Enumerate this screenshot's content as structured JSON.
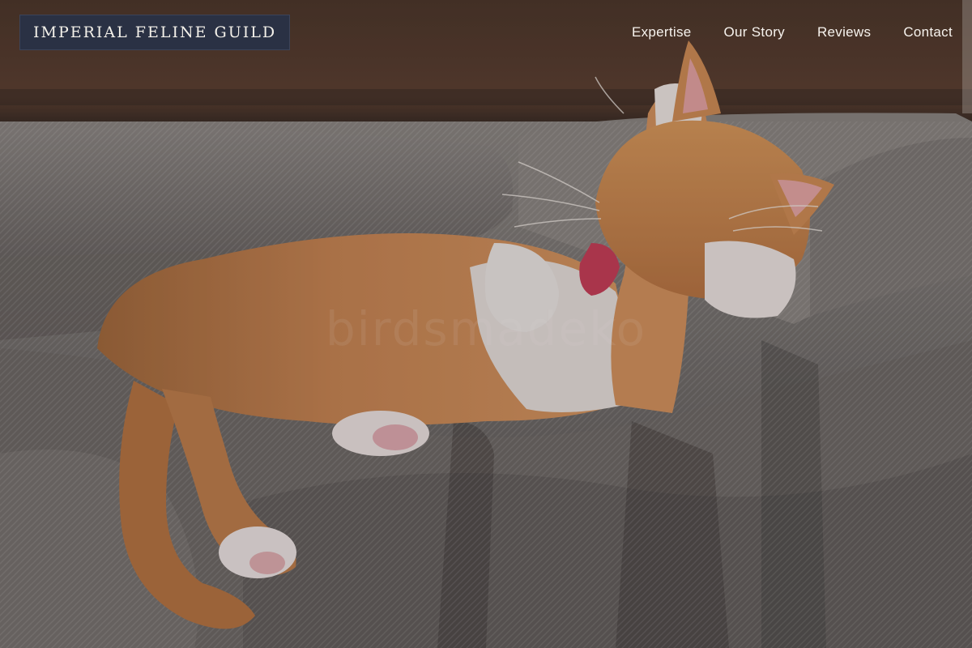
{
  "brand": {
    "name": "IMPERIAL FELINE GUILD"
  },
  "nav": {
    "items": [
      {
        "label": "Expertise"
      },
      {
        "label": "Our Story"
      },
      {
        "label": "Reviews"
      },
      {
        "label": "Contact"
      }
    ]
  },
  "hero": {
    "image_subject": "orange-and-white cat lying on a grey sofa",
    "watermark_text": "birdsmadeko",
    "colors": {
      "logo_background": "#2a3144",
      "text": "#f7f3ee",
      "overlay": "#1e1c24"
    }
  }
}
